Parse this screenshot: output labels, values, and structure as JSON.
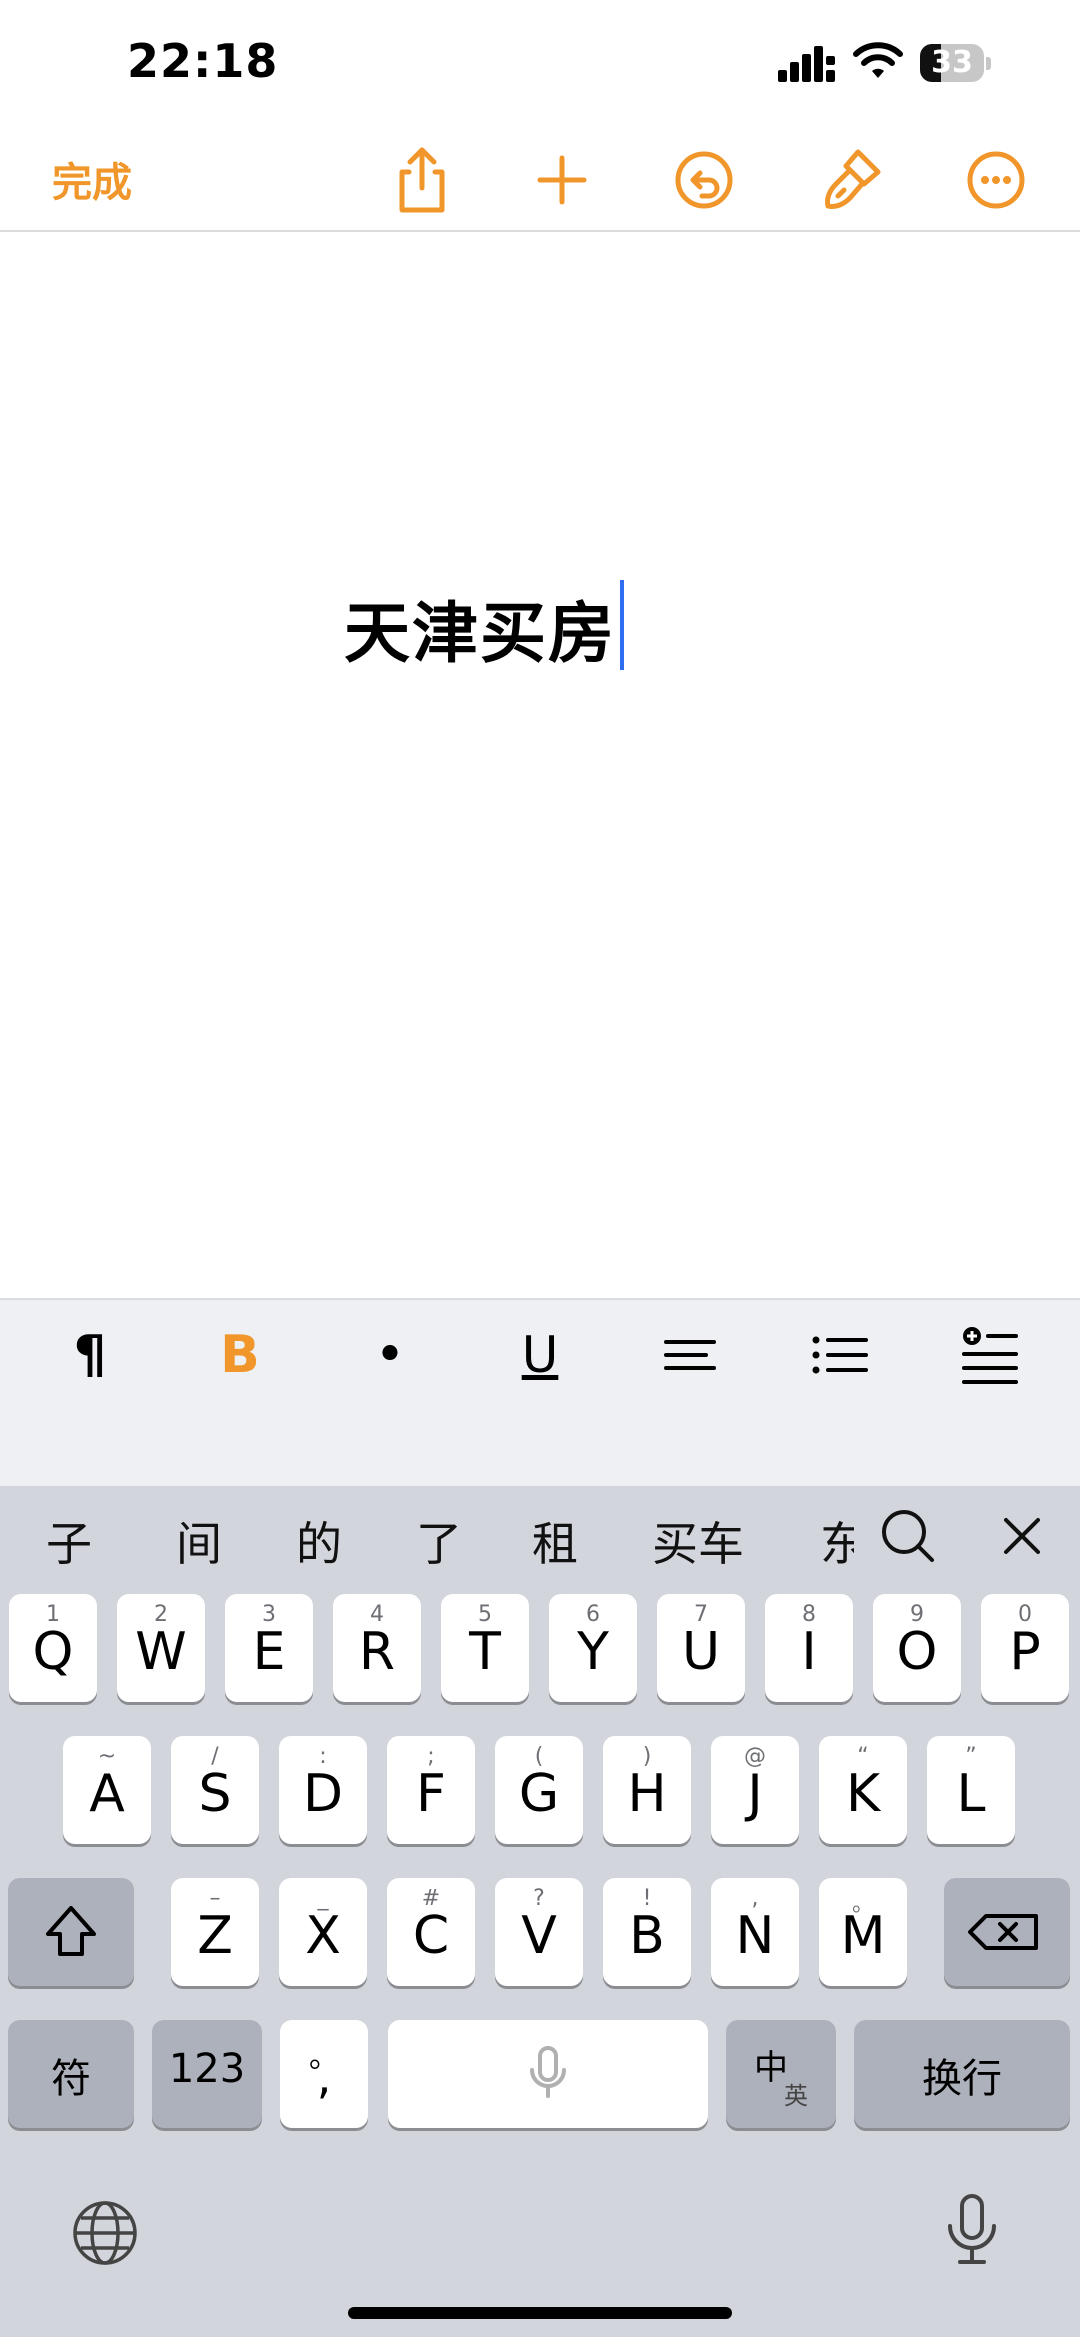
{
  "status": {
    "time": "22:18",
    "battery": 33
  },
  "toolbar": {
    "done": "完成",
    "icons": [
      "share-icon",
      "add-icon",
      "undo-icon",
      "format-brush-icon",
      "more-icon"
    ]
  },
  "document": {
    "title": "天津买房"
  },
  "format_bar": {
    "paragraph": "¶",
    "bold": "B",
    "bullet": "•",
    "underline": "U"
  },
  "candidates": [
    "子",
    "间",
    "的",
    "了",
    "租",
    "买车",
    "东"
  ],
  "keyboard": {
    "row1": [
      [
        "1",
        "Q"
      ],
      [
        "2",
        "W"
      ],
      [
        "3",
        "E"
      ],
      [
        "4",
        "R"
      ],
      [
        "5",
        "T"
      ],
      [
        "6",
        "Y"
      ],
      [
        "7",
        "U"
      ],
      [
        "8",
        "I"
      ],
      [
        "9",
        "O"
      ],
      [
        "0",
        "P"
      ]
    ],
    "row2": [
      [
        "~",
        "A"
      ],
      [
        "/",
        "S"
      ],
      [
        ":",
        "D"
      ],
      [
        ";",
        "F"
      ],
      [
        "(",
        "G"
      ],
      [
        ")",
        "H"
      ],
      [
        "@",
        "J"
      ],
      [
        "“",
        "K"
      ],
      [
        "”",
        "L"
      ]
    ],
    "row3": [
      [
        "–",
        "Z"
      ],
      [
        "_",
        "X"
      ],
      [
        "#",
        "C"
      ],
      [
        "?",
        "V"
      ],
      [
        "!",
        "B"
      ],
      [
        ",",
        "N"
      ],
      [
        "。",
        "M"
      ]
    ],
    "symbol_key": "符",
    "number_key": "123",
    "punct_top": "。",
    "punct_bottom": ",",
    "lang_main": "中",
    "lang_sub": "英",
    "return_key": "换行"
  },
  "colors": {
    "accent": "#f0962a",
    "caret": "#2f6ef0"
  }
}
